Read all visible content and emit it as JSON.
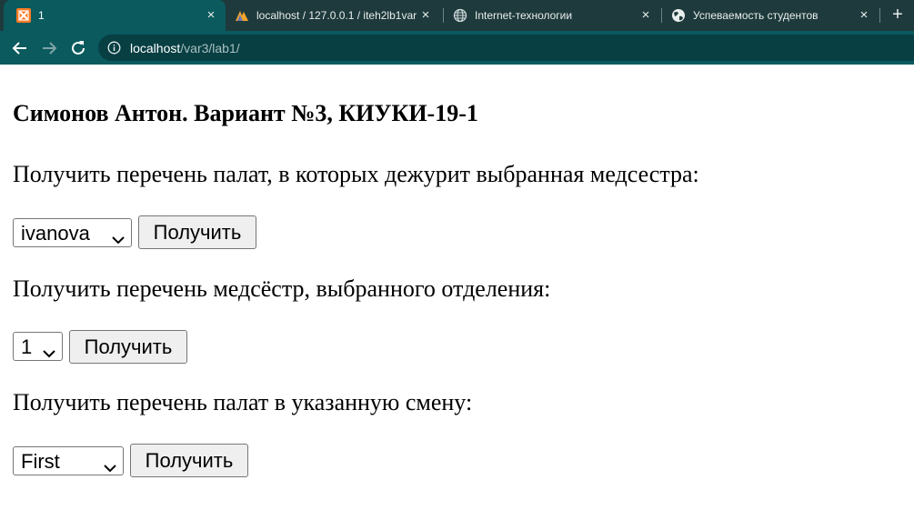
{
  "browser": {
    "tabs": [
      {
        "title": "1",
        "icon": "xampp-icon",
        "active": true
      },
      {
        "title": "localhost / 127.0.0.1 / iteh2lb1var",
        "icon": "phpmyadmin-icon",
        "active": false
      },
      {
        "title": "Internet-технологии",
        "icon": "globe-icon",
        "active": false
      },
      {
        "title": "Успеваемость студентов",
        "icon": "globe-icon",
        "active": false
      }
    ],
    "new_tab_label": "+",
    "close_label": "×",
    "url_host": "localhost",
    "url_path": "/var3/lab1/"
  },
  "page": {
    "heading": "Симонов Антон. Вариант №3, КИУКИ-19-1",
    "forms": [
      {
        "label": "Получить перечень палат, в которых дежурит выбранная медсестра:",
        "selected": "ivanova",
        "button": "Получить"
      },
      {
        "label": "Получить перечень медсёстр, выбранного отделения:",
        "selected": "1",
        "button": "Получить"
      },
      {
        "label": "Получить перечень палат в указанную смену:",
        "selected": "First",
        "button": "Получить"
      }
    ]
  },
  "colors": {
    "tabbar_bg": "#1f3a3c",
    "toolbar_bg": "#0a5a5e",
    "omnibox_bg": "#083f43",
    "button_bg": "#efefef"
  }
}
